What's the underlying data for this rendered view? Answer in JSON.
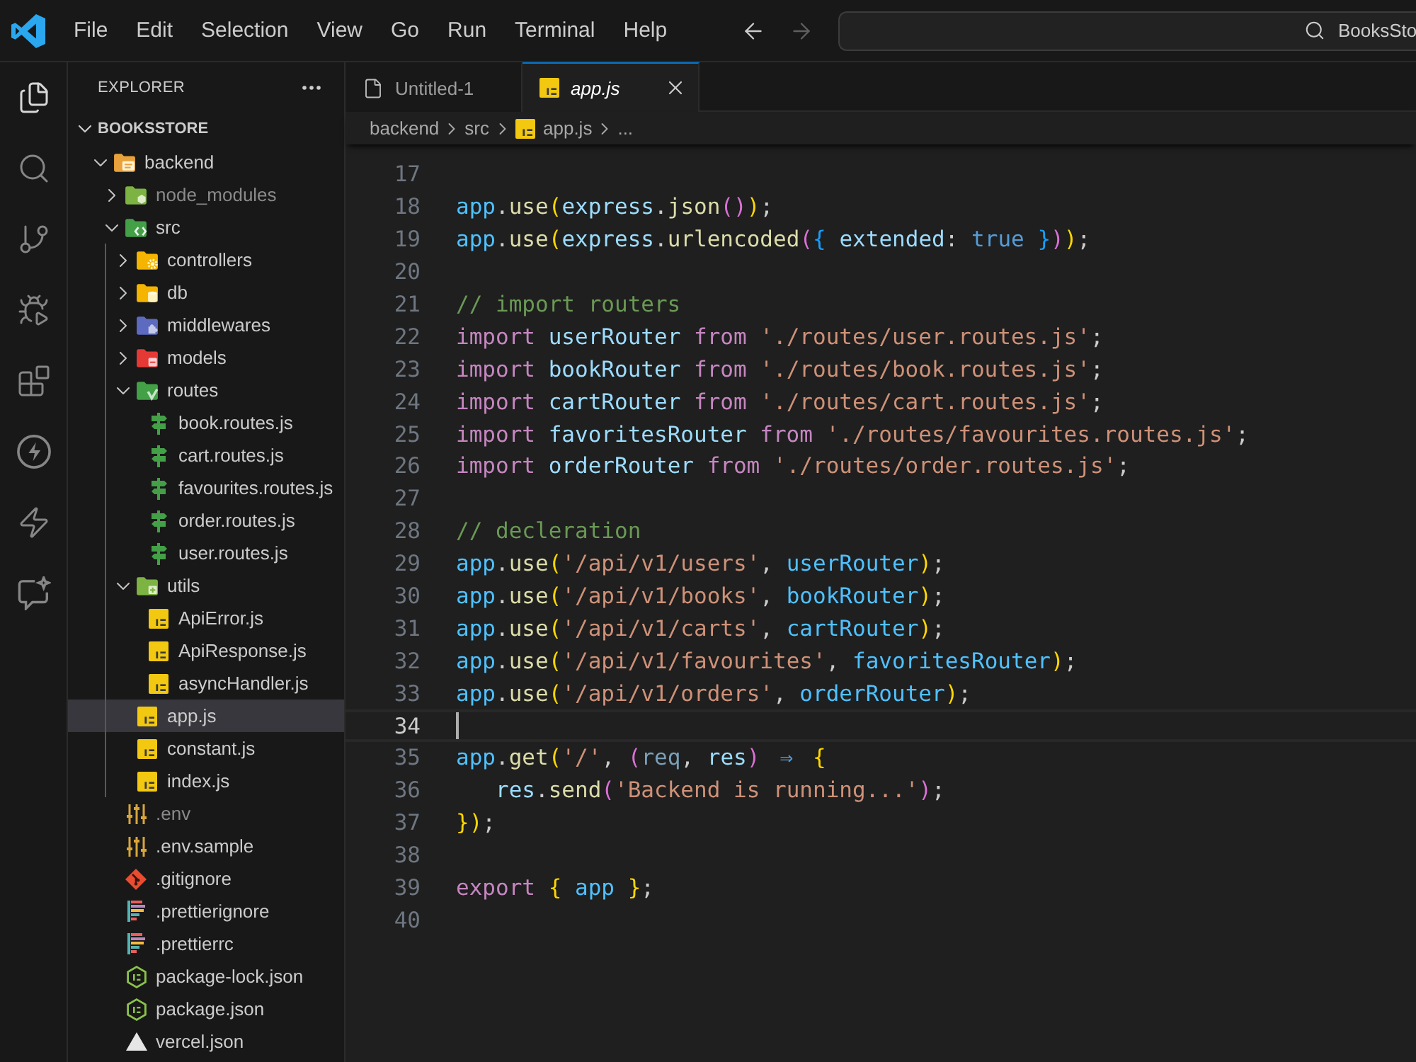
{
  "title_bar": {
    "menu": [
      "File",
      "Edit",
      "Selection",
      "View",
      "Go",
      "Run",
      "Terminal",
      "Help"
    ],
    "back_disabled": false,
    "forward_disabled": true,
    "command_center": {
      "value": "BooksSto"
    }
  },
  "activity_bar": [
    {
      "kind": "files",
      "selected": true
    },
    {
      "kind": "search",
      "selected": false
    },
    {
      "kind": "branch",
      "selected": false
    },
    {
      "kind": "debug",
      "selected": false
    },
    {
      "kind": "blocks",
      "selected": false
    },
    {
      "kind": "boltcircle",
      "selected": false
    },
    {
      "kind": "bolt",
      "selected": false
    },
    {
      "kind": "chat",
      "selected": false
    }
  ],
  "explorer": {
    "title": "EXPLORER",
    "section": {
      "title": "BOOKSSTORE",
      "expanded": true
    },
    "tree": [
      {
        "label": "backend",
        "kind": "appfolder",
        "expanded": true,
        "selected": false,
        "dimmed": false,
        "children": [
          {
            "label": "node_modules",
            "kind": "nodefolder",
            "expanded": false,
            "selected": false,
            "dimmed": true
          },
          {
            "label": "src",
            "kind": "codefolder",
            "expanded": true,
            "selected": false,
            "dimmed": false,
            "children": [
              {
                "label": "controllers",
                "kind": "gearfolder",
                "expanded": false,
                "selected": false,
                "dimmed": false
              },
              {
                "label": "db",
                "kind": "dbfolder",
                "expanded": false,
                "selected": false,
                "dimmed": false
              },
              {
                "label": "middlewares",
                "kind": "plugfolder",
                "expanded": false,
                "selected": false,
                "dimmed": false
              },
              {
                "label": "models",
                "kind": "modelfolder",
                "expanded": false,
                "selected": false,
                "dimmed": false
              },
              {
                "label": "routes",
                "kind": "routefolder",
                "expanded": true,
                "selected": false,
                "dimmed": false,
                "children": [
                  {
                    "label": "book.routes.js",
                    "kind": "route",
                    "selected": false,
                    "dimmed": false
                  },
                  {
                    "label": "cart.routes.js",
                    "kind": "route",
                    "selected": false,
                    "dimmed": false
                  },
                  {
                    "label": "favourites.routes.js",
                    "kind": "route",
                    "selected": false,
                    "dimmed": false
                  },
                  {
                    "label": "order.routes.js",
                    "kind": "route",
                    "selected": false,
                    "dimmed": false
                  },
                  {
                    "label": "user.routes.js",
                    "kind": "route",
                    "selected": false,
                    "dimmed": false
                  }
                ]
              },
              {
                "label": "utils",
                "kind": "utilfolder",
                "expanded": true,
                "selected": false,
                "dimmed": false,
                "children": [
                  {
                    "label": "ApiError.js",
                    "kind": "script",
                    "selected": false,
                    "dimmed": false
                  },
                  {
                    "label": "ApiResponse.js",
                    "kind": "script",
                    "selected": false,
                    "dimmed": false
                  },
                  {
                    "label": "asyncHandler.js",
                    "kind": "script",
                    "selected": false,
                    "dimmed": false
                  }
                ]
              },
              {
                "label": "app.js",
                "kind": "script",
                "selected": true,
                "dimmed": false
              },
              {
                "label": "constant.js",
                "kind": "script",
                "selected": false,
                "dimmed": false
              },
              {
                "label": "index.js",
                "kind": "script",
                "selected": false,
                "dimmed": false
              }
            ]
          },
          {
            "label": ".env",
            "kind": "config",
            "selected": false,
            "dimmed": true
          },
          {
            "label": ".env.sample",
            "kind": "config",
            "selected": false,
            "dimmed": false
          },
          {
            "label": ".gitignore",
            "kind": "git",
            "selected": false,
            "dimmed": false
          },
          {
            "label": ".prettierignore",
            "kind": "prettier",
            "selected": false,
            "dimmed": false
          },
          {
            "label": ".prettierrc",
            "kind": "prettier",
            "selected": false,
            "dimmed": false
          },
          {
            "label": "package-lock.json",
            "kind": "package",
            "selected": false,
            "dimmed": false
          },
          {
            "label": "package.json",
            "kind": "package",
            "selected": false,
            "dimmed": false
          },
          {
            "label": "vercel.json",
            "kind": "vercel",
            "selected": false,
            "dimmed": false
          }
        ]
      }
    ]
  },
  "tabs": [
    {
      "label": "Untitled-1",
      "kind": "text",
      "selected": false,
      "preview": false
    },
    {
      "label": "app.js",
      "kind": "script",
      "selected": true,
      "preview": true
    }
  ],
  "breadcrumbs": [
    {
      "label": "backend",
      "kind": "folder"
    },
    {
      "label": "src",
      "kind": "folder"
    },
    {
      "label": "app.js",
      "kind": "script"
    },
    {
      "label": "...",
      "kind": "more"
    }
  ],
  "editor": {
    "lines": [
      {
        "number": "17",
        "current": false
      },
      {
        "number": "18",
        "current": false,
        "tokens": [
          {
            "text": "app",
            "kind": "var"
          },
          {
            "text": ".",
            "kind": "plain"
          },
          {
            "text": "use",
            "kind": "func"
          },
          {
            "text": "(",
            "kind": "b1"
          },
          {
            "text": "express",
            "kind": "ident"
          },
          {
            "text": ".",
            "kind": "plain"
          },
          {
            "text": "json",
            "kind": "func"
          },
          {
            "text": "()",
            "kind": "b2"
          },
          {
            "text": ")",
            "kind": "b1"
          },
          {
            "text": ";",
            "kind": "plain"
          }
        ]
      },
      {
        "number": "19",
        "current": false,
        "tokens": [
          {
            "text": "app",
            "kind": "var"
          },
          {
            "text": ".",
            "kind": "plain"
          },
          {
            "text": "use",
            "kind": "func"
          },
          {
            "text": "(",
            "kind": "b1"
          },
          {
            "text": "express",
            "kind": "ident"
          },
          {
            "text": ".",
            "kind": "plain"
          },
          {
            "text": "urlencoded",
            "kind": "func"
          },
          {
            "text": "(",
            "kind": "b2"
          },
          {
            "text": "{",
            "kind": "b3"
          },
          {
            "text": " extended",
            "kind": "ident"
          },
          {
            "text": ": ",
            "kind": "plain"
          },
          {
            "text": "true",
            "kind": "const"
          },
          {
            "text": " }",
            "kind": "b3"
          },
          {
            "text": ")",
            "kind": "b2"
          },
          {
            "text": ")",
            "kind": "b1"
          },
          {
            "text": ";",
            "kind": "plain"
          }
        ]
      },
      {
        "number": "20",
        "current": false
      },
      {
        "number": "21",
        "current": false,
        "tokens": [
          {
            "text": "// import routers",
            "kind": "comment"
          }
        ]
      },
      {
        "number": "22",
        "current": false,
        "tokens": [
          {
            "text": "import",
            "kind": "kw"
          },
          {
            "text": " userRouter",
            "kind": "ident"
          },
          {
            "text": " from",
            "kind": "kw"
          },
          {
            "text": " './routes/user.routes.js'",
            "kind": "string"
          },
          {
            "text": ";",
            "kind": "plain"
          }
        ]
      },
      {
        "number": "23",
        "current": false,
        "tokens": [
          {
            "text": "import",
            "kind": "kw"
          },
          {
            "text": " bookRouter",
            "kind": "ident"
          },
          {
            "text": " from",
            "kind": "kw"
          },
          {
            "text": " './routes/book.routes.js'",
            "kind": "string"
          },
          {
            "text": ";",
            "kind": "plain"
          }
        ]
      },
      {
        "number": "24",
        "current": false,
        "tokens": [
          {
            "text": "import",
            "kind": "kw"
          },
          {
            "text": " cartRouter",
            "kind": "ident"
          },
          {
            "text": " from",
            "kind": "kw"
          },
          {
            "text": " './routes/cart.routes.js'",
            "kind": "string"
          },
          {
            "text": ";",
            "kind": "plain"
          }
        ]
      },
      {
        "number": "25",
        "current": false,
        "tokens": [
          {
            "text": "import",
            "kind": "kw"
          },
          {
            "text": " favoritesRouter",
            "kind": "ident"
          },
          {
            "text": " from",
            "kind": "kw"
          },
          {
            "text": " './routes/favourites.routes.js'",
            "kind": "string"
          },
          {
            "text": ";",
            "kind": "plain"
          }
        ]
      },
      {
        "number": "26",
        "current": false,
        "tokens": [
          {
            "text": "import",
            "kind": "kw"
          },
          {
            "text": " orderRouter",
            "kind": "ident"
          },
          {
            "text": " from",
            "kind": "kw"
          },
          {
            "text": " './routes/order.routes.js'",
            "kind": "string"
          },
          {
            "text": ";",
            "kind": "plain"
          }
        ]
      },
      {
        "number": "27",
        "current": false
      },
      {
        "number": "28",
        "current": false,
        "tokens": [
          {
            "text": "// decleration",
            "kind": "comment"
          }
        ]
      },
      {
        "number": "29",
        "current": false,
        "tokens": [
          {
            "text": "app",
            "kind": "var"
          },
          {
            "text": ".",
            "kind": "plain"
          },
          {
            "text": "use",
            "kind": "func"
          },
          {
            "text": "(",
            "kind": "b1"
          },
          {
            "text": "'/api/v1/users'",
            "kind": "string"
          },
          {
            "text": ", ",
            "kind": "plain"
          },
          {
            "text": "userRouter",
            "kind": "var"
          },
          {
            "text": ")",
            "kind": "b1"
          },
          {
            "text": ";",
            "kind": "plain"
          }
        ]
      },
      {
        "number": "30",
        "current": false,
        "tokens": [
          {
            "text": "app",
            "kind": "var"
          },
          {
            "text": ".",
            "kind": "plain"
          },
          {
            "text": "use",
            "kind": "func"
          },
          {
            "text": "(",
            "kind": "b1"
          },
          {
            "text": "'/api/v1/books'",
            "kind": "string"
          },
          {
            "text": ", ",
            "kind": "plain"
          },
          {
            "text": "bookRouter",
            "kind": "var"
          },
          {
            "text": ")",
            "kind": "b1"
          },
          {
            "text": ";",
            "kind": "plain"
          }
        ]
      },
      {
        "number": "31",
        "current": false,
        "tokens": [
          {
            "text": "app",
            "kind": "var"
          },
          {
            "text": ".",
            "kind": "plain"
          },
          {
            "text": "use",
            "kind": "func"
          },
          {
            "text": "(",
            "kind": "b1"
          },
          {
            "text": "'/api/v1/carts'",
            "kind": "string"
          },
          {
            "text": ", ",
            "kind": "plain"
          },
          {
            "text": "cartRouter",
            "kind": "var"
          },
          {
            "text": ")",
            "kind": "b1"
          },
          {
            "text": ";",
            "kind": "plain"
          }
        ]
      },
      {
        "number": "32",
        "current": false,
        "tokens": [
          {
            "text": "app",
            "kind": "var"
          },
          {
            "text": ".",
            "kind": "plain"
          },
          {
            "text": "use",
            "kind": "func"
          },
          {
            "text": "(",
            "kind": "b1"
          },
          {
            "text": "'/api/v1/favourites'",
            "kind": "string"
          },
          {
            "text": ", ",
            "kind": "plain"
          },
          {
            "text": "favoritesRouter",
            "kind": "var"
          },
          {
            "text": ")",
            "kind": "b1"
          },
          {
            "text": ";",
            "kind": "plain"
          }
        ]
      },
      {
        "number": "33",
        "current": false,
        "tokens": [
          {
            "text": "app",
            "kind": "var"
          },
          {
            "text": ".",
            "kind": "plain"
          },
          {
            "text": "use",
            "kind": "func"
          },
          {
            "text": "(",
            "kind": "b1"
          },
          {
            "text": "'/api/v1/orders'",
            "kind": "string"
          },
          {
            "text": ", ",
            "kind": "plain"
          },
          {
            "text": "orderRouter",
            "kind": "var"
          },
          {
            "text": ")",
            "kind": "b1"
          },
          {
            "text": ";",
            "kind": "plain"
          }
        ]
      },
      {
        "number": "34",
        "current": true
      },
      {
        "number": "35",
        "current": false,
        "tokens": [
          {
            "text": "app",
            "kind": "var"
          },
          {
            "text": ".",
            "kind": "plain"
          },
          {
            "text": "get",
            "kind": "func"
          },
          {
            "text": "(",
            "kind": "b1"
          },
          {
            "text": "'/'",
            "kind": "string"
          },
          {
            "text": ", ",
            "kind": "plain"
          },
          {
            "text": "(",
            "kind": "b2"
          },
          {
            "text": "req",
            "kind": "unused"
          },
          {
            "text": ", ",
            "kind": "plain"
          },
          {
            "text": "res",
            "kind": "ident"
          },
          {
            "text": ") ",
            "kind": "b2"
          },
          {
            "text": "⇒",
            "kind": "arrow"
          },
          {
            "text": " {",
            "kind": "b1"
          }
        ]
      },
      {
        "number": "36",
        "current": false,
        "tokens": [
          {
            "text": "   res",
            "kind": "ident"
          },
          {
            "text": ".",
            "kind": "plain"
          },
          {
            "text": "send",
            "kind": "func"
          },
          {
            "text": "(",
            "kind": "b2"
          },
          {
            "text": "'Backend is running...'",
            "kind": "string"
          },
          {
            "text": ")",
            "kind": "b2"
          },
          {
            "text": ";",
            "kind": "plain"
          }
        ]
      },
      {
        "number": "37",
        "current": false,
        "tokens": [
          {
            "text": "})",
            "kind": "b1"
          },
          {
            "text": ";",
            "kind": "plain"
          }
        ]
      },
      {
        "number": "38",
        "current": false
      },
      {
        "number": "39",
        "current": false,
        "tokens": [
          {
            "text": "export",
            "kind": "kw"
          },
          {
            "text": " {",
            "kind": "b1"
          },
          {
            "text": " app",
            "kind": "var"
          },
          {
            "text": " }",
            "kind": "b1"
          },
          {
            "text": ";",
            "kind": "plain"
          }
        ]
      },
      {
        "number": "40",
        "current": false
      }
    ]
  }
}
